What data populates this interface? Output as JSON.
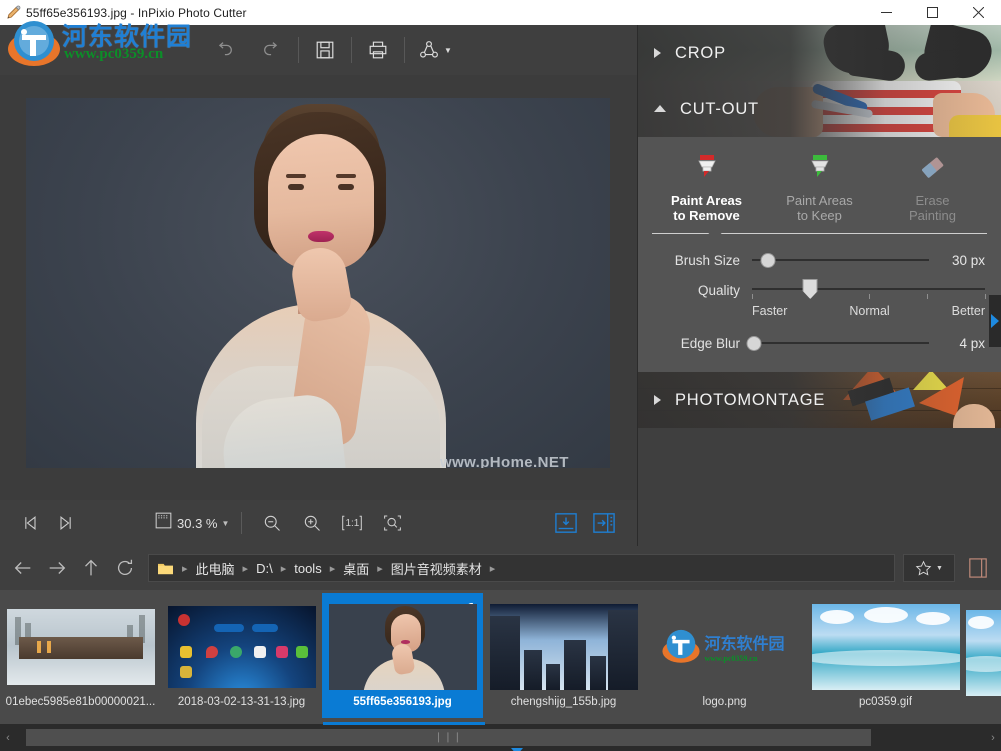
{
  "window": {
    "title": "55ff65e356193.jpg - InPixio Photo Cutter",
    "app_icon": "pencil-icon",
    "minimize_label": "—",
    "maximize_label": "□",
    "close_label": "✕"
  },
  "watermark": {
    "logo_cn": "河东软件园",
    "logo_url": "www.pc0359.cn",
    "photo_text": "www.pHome.NET"
  },
  "toolbar": {
    "buttons": [
      {
        "name": "undo-button",
        "icon": "undo-icon",
        "enabled": false
      },
      {
        "name": "redo-button",
        "icon": "redo-icon",
        "enabled": false
      },
      {
        "name": "save-button",
        "icon": "save-icon",
        "enabled": true
      },
      {
        "name": "print-button",
        "icon": "print-icon",
        "enabled": true
      },
      {
        "name": "share-button",
        "icon": "share-icon",
        "enabled": true
      }
    ]
  },
  "statusbar": {
    "first_label": "first-image",
    "next_label": "next-image",
    "zoom_value": "30.3 %",
    "zoom_out_label": "Zoom out",
    "zoom_in_label": "Zoom in",
    "actual_size_label": "1:1",
    "fit_label": "Fit to window",
    "export_buttons": [
      "save-to-file",
      "open-in-editor"
    ]
  },
  "panel": {
    "sections": [
      {
        "id": "crop",
        "label": "CROP",
        "expanded": false
      },
      {
        "id": "cutout",
        "label": "CUT-OUT",
        "expanded": true
      },
      {
        "id": "photomontage",
        "label": "PHOTOMONTAGE",
        "expanded": false
      }
    ],
    "cutout": {
      "tools": [
        {
          "name": "paint-areas-to-remove",
          "line1": "Paint Areas",
          "line2": "to Remove",
          "state": "active",
          "icon": "red-marker-icon"
        },
        {
          "name": "paint-areas-to-keep",
          "line1": "Paint Areas",
          "line2": "to Keep",
          "state": "inactive",
          "icon": "green-marker-icon"
        },
        {
          "name": "erase-painting",
          "line1": "Erase",
          "line2": "Painting",
          "state": "disabled",
          "icon": "eraser-icon"
        }
      ],
      "brush_size": {
        "label": "Brush Size",
        "value": "30 px",
        "percent": 9
      },
      "quality": {
        "label": "Quality",
        "percent": 25,
        "ticks": [
          0,
          25,
          50,
          75,
          100
        ],
        "scale": [
          "Faster",
          "Normal",
          "Better"
        ]
      },
      "edge_blur": {
        "label": "Edge Blur",
        "value": "4 px",
        "percent": 1
      }
    },
    "collapse_handle": "collapse-panel-arrow"
  },
  "navbar": {
    "back_label": "Back",
    "forward_label": "Forward",
    "up_label": "Up",
    "refresh_label": "Refresh",
    "breadcrumbs": [
      "此电脑",
      "D:\\",
      "tools",
      "桌面",
      "图片音视频素材"
    ],
    "favorites_label": "favorites-star",
    "panel_toggle_label": "toggle-preview-panel"
  },
  "filmstrip": {
    "items": [
      {
        "name": "01ebec5985e81b00000021...",
        "type": "building",
        "selected": false
      },
      {
        "name": "2018-03-02-13-31-13.jpg",
        "type": "android",
        "selected": false
      },
      {
        "name": "55ff65e356193.jpg",
        "type": "portrait",
        "selected": true
      },
      {
        "name": "chengshijg_155b.jpg",
        "type": "city",
        "selected": false
      },
      {
        "name": "logo.png",
        "type": "logo",
        "selected": false
      },
      {
        "name": "pc0359.gif",
        "type": "sea",
        "selected": false
      },
      {
        "name": "",
        "type": "sea",
        "selected": false
      }
    ]
  },
  "scrollbar": {
    "grip": "❘❘❘",
    "left_arrow": "‹",
    "right_arrow": "›"
  },
  "colors": {
    "accent": "#0a7bd4",
    "panel_bg": "#3f3f3f",
    "cutout_bg": "#545454",
    "filmstrip_bg": "#4a4a4a",
    "titlebar_bg": "#ffffff"
  }
}
